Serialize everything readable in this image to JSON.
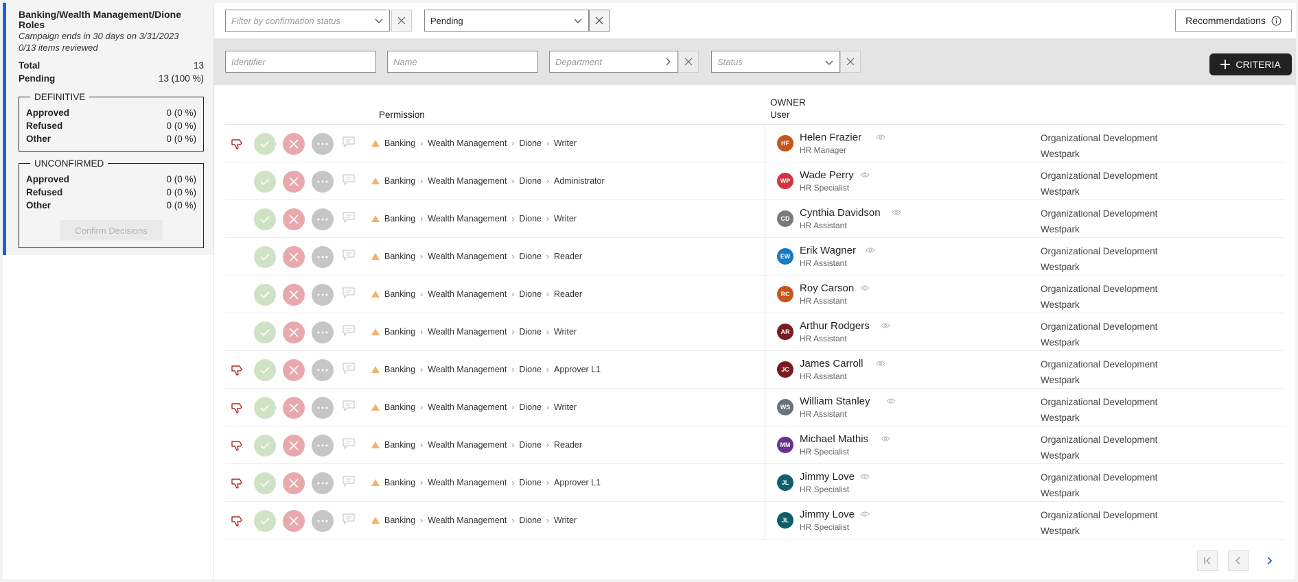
{
  "campaign": {
    "title": "Banking/Wealth Management/Dione Roles",
    "ends": "Campaign ends in 30 days on 3/31/2023",
    "reviewed": "0/13 items reviewed",
    "total_label": "Total",
    "total_value": "13",
    "pending_label": "Pending",
    "pending_value": "13 (100 %)",
    "definitive": {
      "legend": "DEFINITIVE",
      "approved_label": "Approved",
      "approved_value": "0 (0 %)",
      "refused_label": "Refused",
      "refused_value": "0 (0 %)",
      "other_label": "Other",
      "other_value": "0 (0 %)"
    },
    "unconfirmed": {
      "legend": "UNCONFIRMED",
      "approved_label": "Approved",
      "approved_value": "0 (0 %)",
      "refused_label": "Refused",
      "refused_value": "0 (0 %)",
      "other_label": "Other",
      "other_value": "0 (0 %)"
    },
    "confirm_label": "Confirm Decisions"
  },
  "topbar": {
    "confirmation_placeholder": "Filter by confirmation status",
    "status_value": "Pending",
    "recommendations_label": "Recommendations"
  },
  "filters": {
    "identifier_placeholder": "Identifier",
    "name_placeholder": "Name",
    "department_placeholder": "Department",
    "status_placeholder": "Status",
    "criteria_label": "CRITERIA"
  },
  "table": {
    "permission_header": "Permission",
    "owner_header": "OWNER",
    "user_header": "User",
    "rows": [
      {
        "thumb": true,
        "path": [
          "Banking",
          "Wealth Management",
          "Dione",
          "Writer"
        ],
        "initials": "HF",
        "avatar_color": "#c8551c",
        "name": "Helen Frazier",
        "role": "HR Manager",
        "dept1": "Organizational Development",
        "dept2": "Westpark"
      },
      {
        "thumb": false,
        "path": [
          "Banking",
          "Wealth Management",
          "Dione",
          "Administrator"
        ],
        "initials": "WP",
        "avatar_color": "#d23440",
        "name": "Wade Perry",
        "role": "HR Specialist",
        "dept1": "Organizational Development",
        "dept2": "Westpark"
      },
      {
        "thumb": false,
        "path": [
          "Banking",
          "Wealth Management",
          "Dione",
          "Writer"
        ],
        "initials": "CD",
        "avatar_color": "#7a7a7a",
        "name": "Cynthia Davidson",
        "role": "HR Assistant",
        "dept1": "Organizational Development",
        "dept2": "Westpark"
      },
      {
        "thumb": false,
        "path": [
          "Banking",
          "Wealth Management",
          "Dione",
          "Reader"
        ],
        "initials": "EW",
        "avatar_color": "#1a78c2",
        "name": "Erik Wagner",
        "role": "HR Assistant",
        "dept1": "Organizational Development",
        "dept2": "Westpark"
      },
      {
        "thumb": false,
        "path": [
          "Banking",
          "Wealth Management",
          "Dione",
          "Reader"
        ],
        "initials": "RC",
        "avatar_color": "#c8551c",
        "name": "Roy Carson",
        "role": "HR Assistant",
        "dept1": "Organizational Development",
        "dept2": "Westpark"
      },
      {
        "thumb": false,
        "path": [
          "Banking",
          "Wealth Management",
          "Dione",
          "Writer"
        ],
        "initials": "AR",
        "avatar_color": "#7a1a22",
        "name": "Arthur Rodgers",
        "role": "HR Assistant",
        "dept1": "Organizational Development",
        "dept2": "Westpark"
      },
      {
        "thumb": true,
        "path": [
          "Banking",
          "Wealth Management",
          "Dione",
          "Approver L1"
        ],
        "initials": "JC",
        "avatar_color": "#7a1a22",
        "name": "James Carroll",
        "role": "HR Assistant",
        "dept1": "Organizational Development",
        "dept2": "Westpark"
      },
      {
        "thumb": true,
        "path": [
          "Banking",
          "Wealth Management",
          "Dione",
          "Writer"
        ],
        "initials": "WS",
        "avatar_color": "#6a7478",
        "name": "William Stanley",
        "role": "HR Assistant",
        "dept1": "Organizational Development",
        "dept2": "Westpark"
      },
      {
        "thumb": true,
        "path": [
          "Banking",
          "Wealth Management",
          "Dione",
          "Reader"
        ],
        "initials": "MM",
        "avatar_color": "#6a3192",
        "name": "Michael Mathis",
        "role": "HR Specialist",
        "dept1": "Organizational Development",
        "dept2": "Westpark"
      },
      {
        "thumb": true,
        "path": [
          "Banking",
          "Wealth Management",
          "Dione",
          "Approver L1"
        ],
        "initials": "JL",
        "avatar_color": "#0e5f6a",
        "name": "Jimmy Love",
        "role": "HR Specialist",
        "dept1": "Organizational Development",
        "dept2": "Westpark"
      },
      {
        "thumb": true,
        "path": [
          "Banking",
          "Wealth Management",
          "Dione",
          "Writer"
        ],
        "initials": "JL",
        "avatar_color": "#0e5f6a",
        "name": "Jimmy Love",
        "role": "HR Specialist",
        "dept1": "Organizational Development",
        "dept2": "Westpark"
      }
    ]
  },
  "icons": {
    "thumb": "thumbs-down-icon",
    "approve": "check-icon",
    "refuse": "close-icon",
    "more": "more-horizontal-icon",
    "comment": "comment-icon",
    "warning": "warning-triangle-icon",
    "eye": "eye-icon"
  }
}
